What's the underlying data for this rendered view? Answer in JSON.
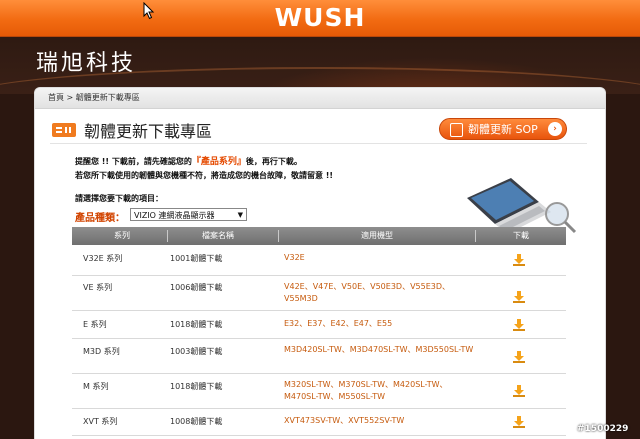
{
  "topbar": {
    "brand": "WUSH"
  },
  "header": {
    "logo_text": "瑞旭科技"
  },
  "breadcrumb": {
    "text": "首頁 > 韌體更新下載專區"
  },
  "page": {
    "title": "韌體更新下載專區",
    "sop_button": "韌體更新 SOP"
  },
  "notice": {
    "line1_prefix": "提醒您 !! 下載前，請先確認您的",
    "line1_highlight": "『產品系列』",
    "line1_suffix": "後，再行下載。",
    "line2": "若您所下載使用的韌體與您機種不符，將造成您的機台故障，敬請留意 !!"
  },
  "selector": {
    "prompt": "請選擇您要下載的項目：",
    "category_label": "產品種類：",
    "category_value": "VIZIO 連網液晶顯示器"
  },
  "table": {
    "headers": [
      "系列",
      "檔案名稱",
      "適用機型",
      "下載"
    ],
    "rows": [
      {
        "series": "V32E 系列",
        "file": "1001韌體下載",
        "models": "V32E"
      },
      {
        "series": "VE 系列",
        "file": "1006韌體下載",
        "models": "V42E、V47E、V50E、V50E3D、V55E3D、V55M3D"
      },
      {
        "series": "E 系列",
        "file": "1018韌體下載",
        "models": "E32、E37、E42、E47、E55"
      },
      {
        "series": "M3D 系列",
        "file": "1003韌體下載",
        "models": "M3D420SL-TW、M3D470SL-TW、M3D550SL-TW"
      },
      {
        "series": "M 系列",
        "file": "1018韌體下載",
        "models": "M320SL-TW、M370SL-TW、M420SL-TW、M470SL-TW、M550SL-TW"
      },
      {
        "series": "XVT 系列",
        "file": "1008韌體下載",
        "models": "XVT473SV-TW、XVT552SV-TW"
      }
    ]
  },
  "watermark": "#1500229",
  "colors": {
    "accent": "#f26b12",
    "link": "#c65b0e",
    "highlight": "#d24400"
  }
}
